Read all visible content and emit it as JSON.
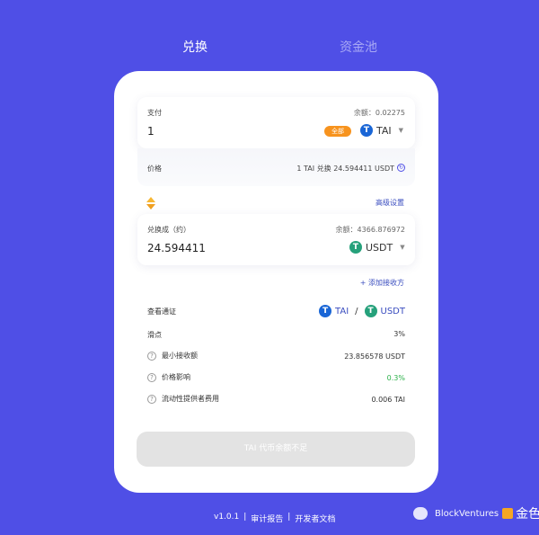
{
  "tabs": {
    "swap": "兑换",
    "pool": "资金池"
  },
  "pay": {
    "label": "支付",
    "balance": "余额：0.02275",
    "amount": "1",
    "max_label": "全部",
    "token": "TAI",
    "token_icon": "tai-icon"
  },
  "price": {
    "label": "价格",
    "value": "1 TAI 兑换 24.594411 USDT"
  },
  "advanced_settings": "高级设置",
  "receive": {
    "label": "兑换成（约）",
    "balance": "余额：4366.876972",
    "amount": "24.594411",
    "token": "USDT",
    "token_icon": "usdt-icon"
  },
  "add_recipient": "+ 添加接收方",
  "info": {
    "view_token_label": "查看通证",
    "token_a": "TAI",
    "separator": "/",
    "token_b": "USDT",
    "slippage_label": "滑点",
    "slippage_value": "3%",
    "min_received_label": "最小接收额",
    "min_received_value": "23.856578 USDT",
    "price_impact_label": "价格影响",
    "price_impact_value": "0.3%",
    "lp_fee_label": "流动性提供者费用",
    "lp_fee_value": "0.006 TAI"
  },
  "submit_label": "TAI 代币余额不足",
  "footer": {
    "version": "v1.0.1",
    "sep": "|",
    "audit": "审计报告",
    "docs": "开发者文档"
  },
  "watermark": {
    "brand": "BlockVentures",
    "cn": "金色财经"
  },
  "colors": {
    "background": "#4f4fe6",
    "accent_orange": "#f7931e",
    "link_blue": "#3a4dbf",
    "positive_green": "#2cb14a",
    "tai_blue": "#1a66d6",
    "usdt_green": "#26a17b"
  }
}
